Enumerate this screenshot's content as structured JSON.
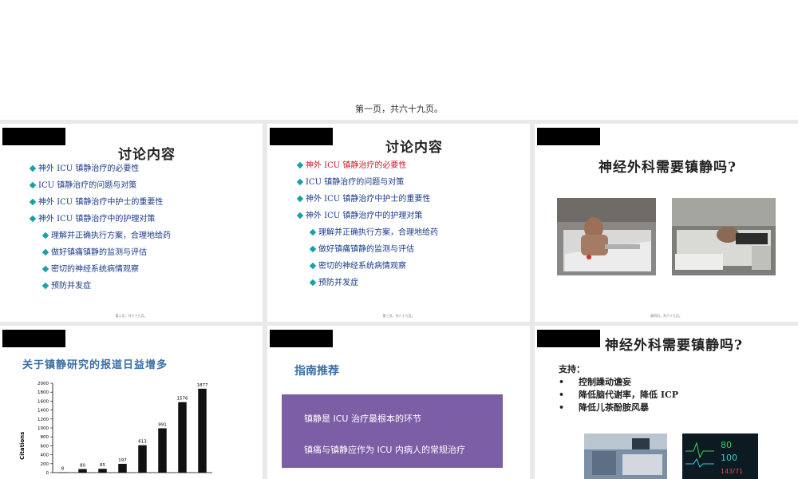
{
  "header": {
    "page_label": "第一页，共六十九页。"
  },
  "slide2": {
    "title": "讨论内容",
    "items": [
      "神外 ICU 镇静治疗的必要性",
      "ICU 镇静治疗的问题与对策",
      "神外 ICU 镇静治疗中护士的重要性",
      "神外 ICU 镇静治疗中的护理对策"
    ],
    "subitems": [
      "理解并正确执行方案，合理地给药",
      "做好镇痛镇静的监测与评估",
      "密切的神经系统病情观察",
      "预防并发症"
    ],
    "footer": "第二页，共六十九页。"
  },
  "slide3": {
    "title": "讨论内容",
    "items": [
      "神外 ICU 镇静治疗的必要性",
      "ICU 镇静治疗的问题与对策",
      "神外 ICU 镇静治疗中护士的重要性",
      "神外 ICU 镇静治疗中的护理对策"
    ],
    "subitems": [
      "理解并正确执行方案，合理地给药",
      "做好镇痛镇静的监测与评估",
      "密切的神经系统病情观察",
      "预防并发症"
    ],
    "footer": "第三页，共六十九页。"
  },
  "slide4": {
    "title": "神经外科需要镇静吗?",
    "footer": "第四页，共六十九页。"
  },
  "slide5": {
    "title": "关于镇静研究的报道日益增多"
  },
  "slide6": {
    "title": "指南推荐",
    "line1": "镇静是 ICU 治疗最根本的环节",
    "line2": "镇痛与镇静应作为 ICU 内病人的常规治疗"
  },
  "slide7": {
    "title": "神经外科需要镇静吗?",
    "support_label": "支持：",
    "points": [
      "控制躁动谵妄",
      "降低脑代谢率，降低 ICP",
      "降低儿茶酚胺风暴"
    ],
    "monitor_values": [
      "80",
      "100",
      "143/71"
    ]
  },
  "chart_data": {
    "type": "bar",
    "ylabel": "Citations",
    "ylim": [
      0,
      2000
    ],
    "yticks": [
      0,
      200,
      400,
      600,
      800,
      1000,
      1200,
      1400,
      1600,
      1800,
      2000
    ],
    "values": [
      8,
      80,
      85,
      197,
      613,
      991,
      1576,
      1877
    ],
    "bar_color": "#111111"
  }
}
